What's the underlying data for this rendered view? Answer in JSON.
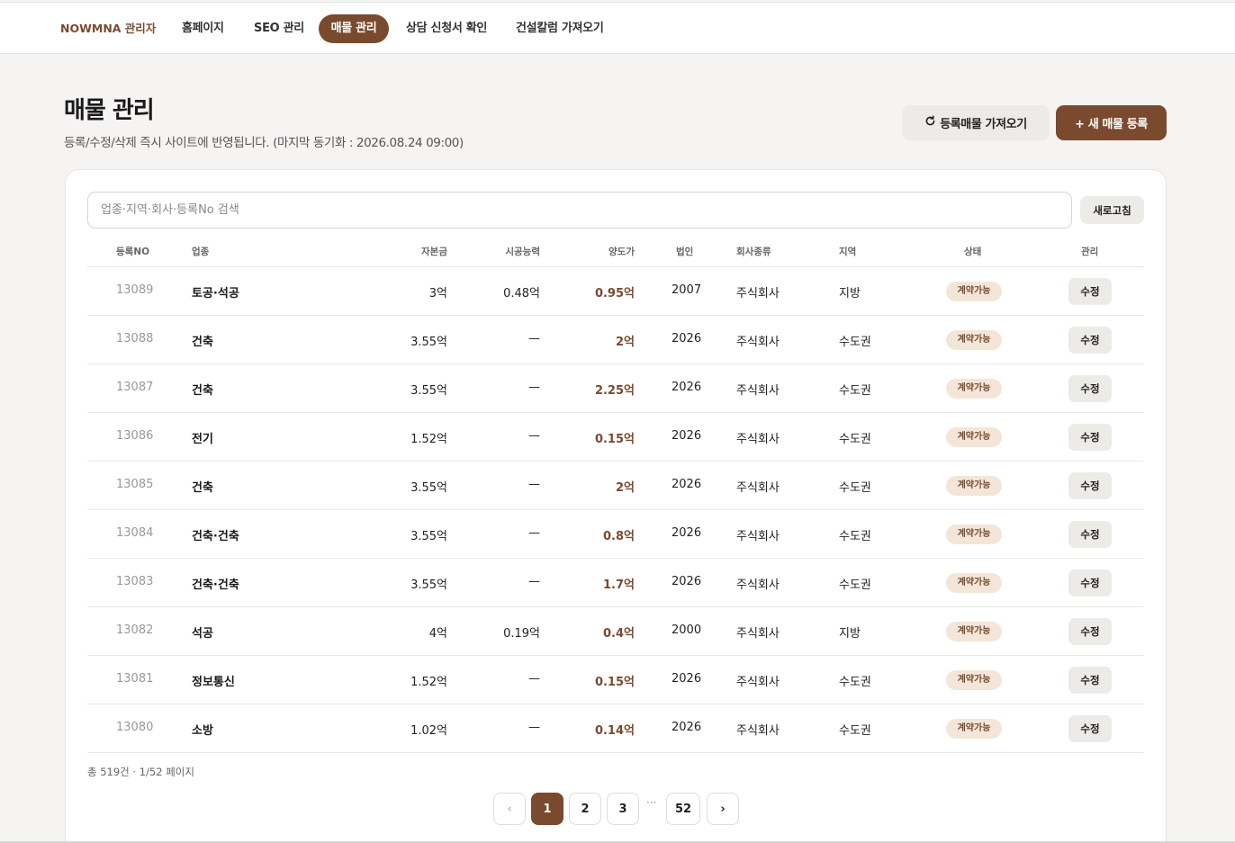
{
  "nav": {
    "brand": "NOWMNA 관리자",
    "items": [
      "홈페이지",
      "SEO 관리",
      "매물 관리",
      "상담 신청서 확인",
      "건설칼럼 가져오기"
    ]
  },
  "header": {
    "title": "매물 관리",
    "subtitle": "등록/수정/삭제 즉시 사이트에 반영됩니다. (마지막 동기화 : 2026.08.24 09:00)",
    "import_button": "등록매물 가져오기",
    "new_button": "+ 새 매물 등록"
  },
  "search": {
    "placeholder": "업종·지역·회사·등록No 검색",
    "refresh_button": "새로고침"
  },
  "table": {
    "columns": [
      "등록NO",
      "업종",
      "자본금",
      "시공능력",
      "양도가",
      "법인",
      "회사종류",
      "지역",
      "상태",
      "관리"
    ],
    "rows": [
      {
        "no": "13089",
        "type": "토공·석공",
        "capital": "3억",
        "perf": "0.48억",
        "price": "0.95억",
        "year": "2007",
        "kind": "주식회사",
        "region": "지방",
        "status": "계약가능",
        "action": "수정"
      },
      {
        "no": "13088",
        "type": "건축",
        "capital": "3.55억",
        "perf": "—",
        "price": "2억",
        "year": "2026",
        "kind": "주식회사",
        "region": "수도권",
        "status": "계약가능",
        "action": "수정"
      },
      {
        "no": "13087",
        "type": "건축",
        "capital": "3.55억",
        "perf": "—",
        "price": "2.25억",
        "year": "2026",
        "kind": "주식회사",
        "region": "수도권",
        "status": "계약가능",
        "action": "수정"
      },
      {
        "no": "13086",
        "type": "전기",
        "capital": "1.52억",
        "perf": "—",
        "price": "0.15억",
        "year": "2026",
        "kind": "주식회사",
        "region": "수도권",
        "status": "계약가능",
        "action": "수정"
      },
      {
        "no": "13085",
        "type": "건축",
        "capital": "3.55억",
        "perf": "—",
        "price": "2억",
        "year": "2026",
        "kind": "주식회사",
        "region": "수도권",
        "status": "계약가능",
        "action": "수정"
      },
      {
        "no": "13084",
        "type": "건축·건축",
        "capital": "3.55억",
        "perf": "—",
        "price": "0.8억",
        "year": "2026",
        "kind": "주식회사",
        "region": "수도권",
        "status": "계약가능",
        "action": "수정"
      },
      {
        "no": "13083",
        "type": "건축·건축",
        "capital": "3.55억",
        "perf": "—",
        "price": "1.7억",
        "year": "2026",
        "kind": "주식회사",
        "region": "수도권",
        "status": "계약가능",
        "action": "수정"
      },
      {
        "no": "13082",
        "type": "석공",
        "capital": "4억",
        "perf": "0.19억",
        "price": "0.4억",
        "year": "2000",
        "kind": "주식회사",
        "region": "지방",
        "status": "계약가능",
        "action": "수정"
      },
      {
        "no": "13081",
        "type": "정보통신",
        "capital": "1.52억",
        "perf": "—",
        "price": "0.15억",
        "year": "2026",
        "kind": "주식회사",
        "region": "수도권",
        "status": "계약가능",
        "action": "수정"
      },
      {
        "no": "13080",
        "type": "소방",
        "capital": "1.02억",
        "perf": "—",
        "price": "0.14억",
        "year": "2026",
        "kind": "주식회사",
        "region": "수도권",
        "status": "계약가능",
        "action": "수정"
      }
    ]
  },
  "footer": {
    "total": "총 519건 · 1/52 페이지"
  },
  "pagination": {
    "prev": "‹",
    "pages": [
      "1",
      "2",
      "3"
    ],
    "ellipsis": "···",
    "last": "52",
    "next": "›"
  },
  "colors": {
    "accent": "#7a4a2f",
    "badge_bg": "#f3e6d9"
  }
}
